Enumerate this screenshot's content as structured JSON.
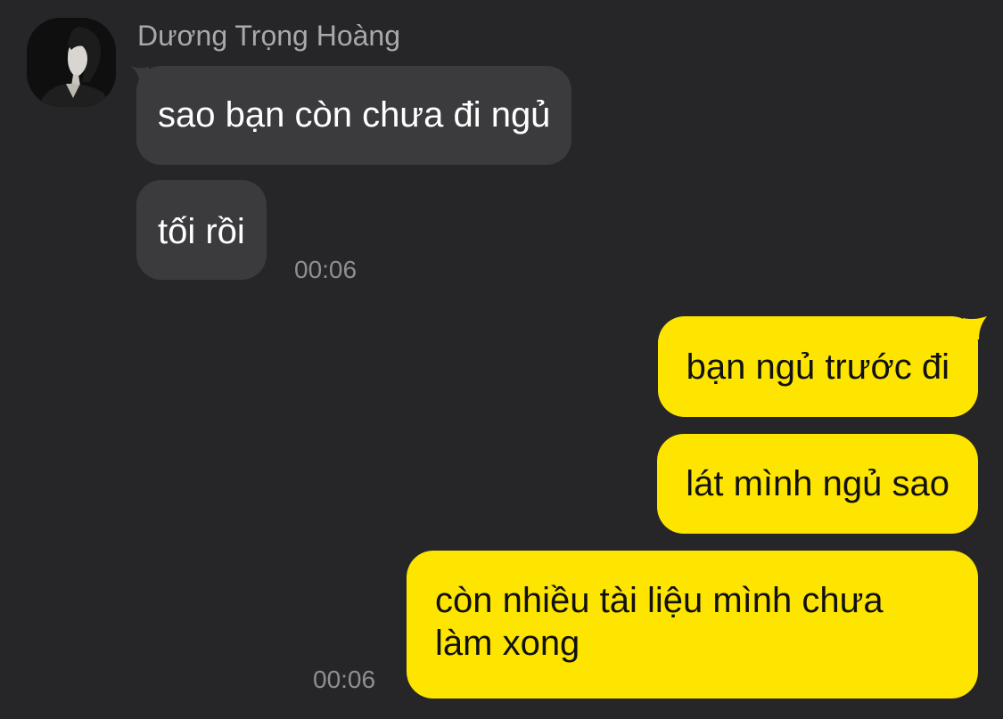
{
  "contact": {
    "name": "Dương Trọng Hoàng",
    "avatar_icon": "profile-photo"
  },
  "incoming": {
    "messages": [
      {
        "text": "sao bạn còn chưa đi ngủ"
      },
      {
        "text": "tối rồi"
      }
    ],
    "time": "00:06"
  },
  "outgoing": {
    "messages": [
      {
        "text": "bạn ngủ trước đi"
      },
      {
        "text": "lát mình ngủ sao"
      },
      {
        "text": "còn nhiều tài liệu mình chưa làm xong"
      }
    ],
    "time": "00:06"
  },
  "colors": {
    "background": "#262628",
    "incoming_bubble": "#3b3b3e",
    "outgoing_bubble": "#fee500",
    "name_text": "#a9a9ad",
    "timestamp_text": "#8e8e93"
  }
}
